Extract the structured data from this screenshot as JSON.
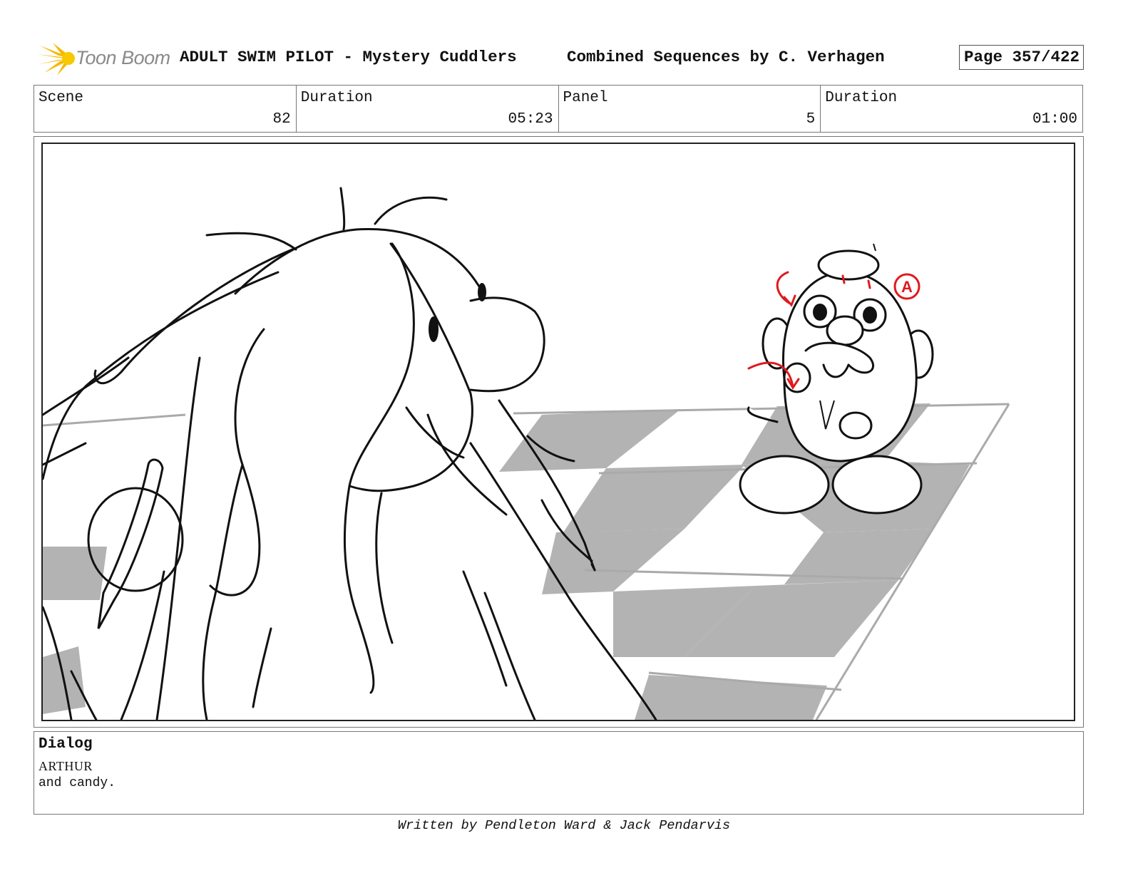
{
  "header": {
    "logo_text": "Toon Boom",
    "project_title": "ADULT SWIM PILOT - Mystery Cuddlers",
    "sequence_title": "Combined Sequences by C. Verhagen",
    "page_label": "Page 357/422"
  },
  "info": {
    "scene_label": "Scene",
    "scene_value": "82",
    "scene_duration_label": "Duration",
    "scene_duration_value": "05:23",
    "panel_label": "Panel",
    "panel_value": "5",
    "panel_duration_label": "Duration",
    "panel_duration_value": "01:00"
  },
  "panel": {
    "annotation_letter": "A",
    "annotation_color": "#e0191e",
    "floor_shade_color": "#b3b3b3"
  },
  "dialog": {
    "heading": "Dialog",
    "speaker": "ARTHUR",
    "line": "and candy."
  },
  "footer": {
    "credit": "Written by Pendleton Ward & Jack Pendarvis"
  }
}
